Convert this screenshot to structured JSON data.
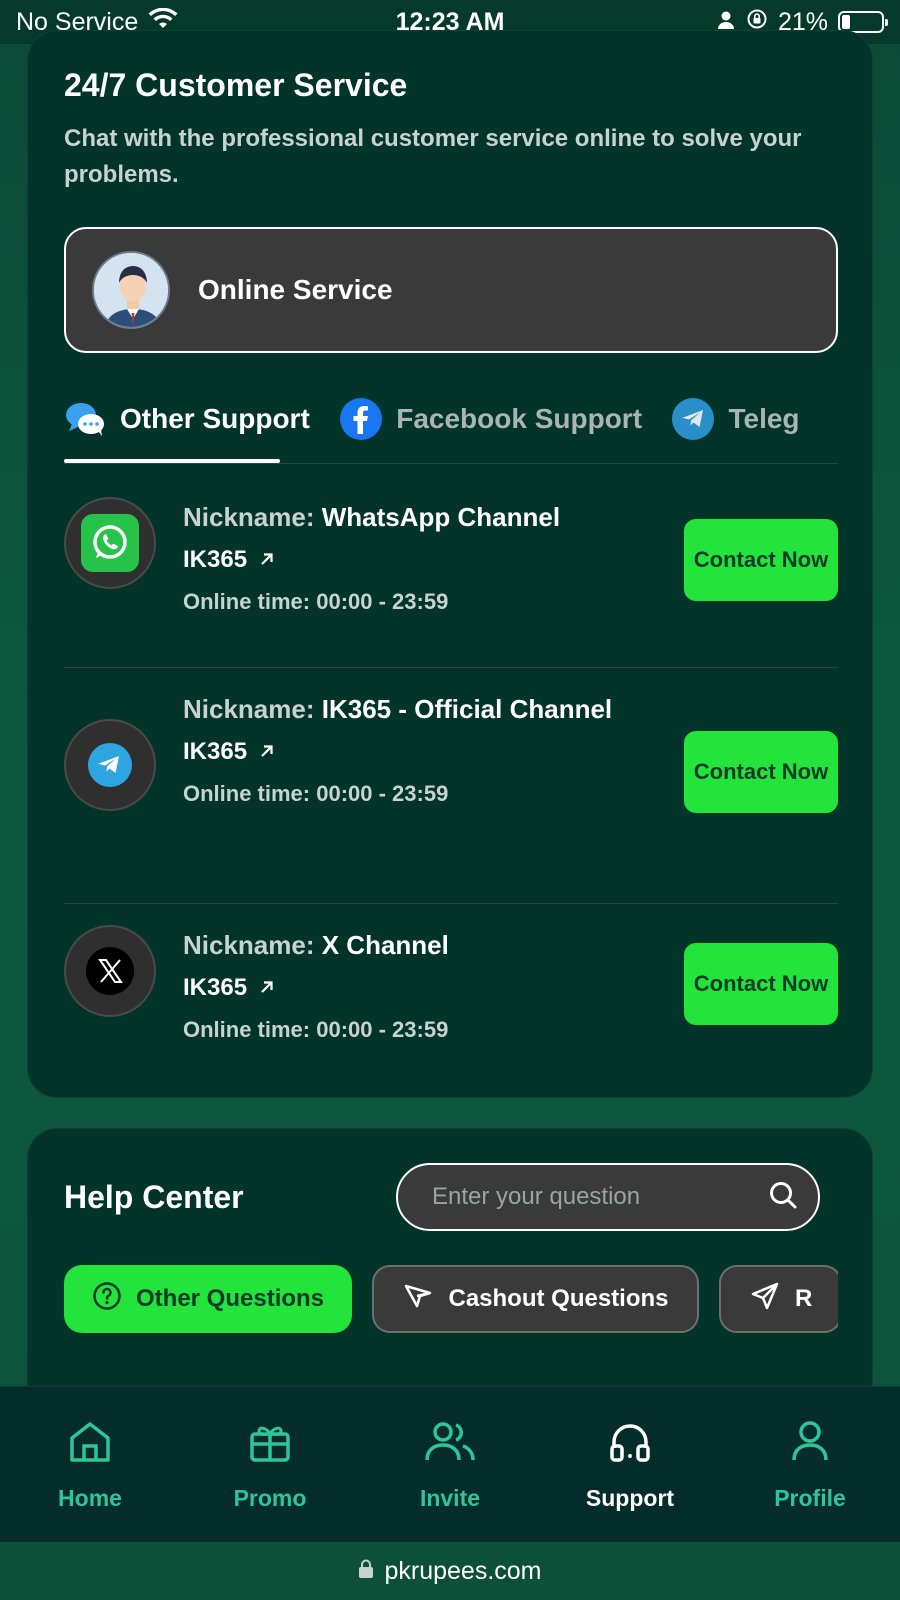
{
  "status_bar": {
    "carrier": "No Service",
    "time": "12:23 AM",
    "battery": "21%",
    "battery_level": 0.21
  },
  "customer_service": {
    "title": "24/7 Customer Service",
    "description": "Chat with the professional customer service online to solve your problems.",
    "online_service_label": "Online Service"
  },
  "support_tabs": [
    {
      "label": "Other Support",
      "icon": "chat-bubbles-icon",
      "active": true
    },
    {
      "label": "Facebook Support",
      "icon": "facebook-icon",
      "active": false
    },
    {
      "label": "Teleg",
      "icon": "telegram-icon",
      "active": false
    }
  ],
  "channels": [
    {
      "nickname_prefix": "Nickname:",
      "nickname": "WhatsApp Channel",
      "handle": "IK365",
      "online_time": "Online time: 00:00 - 23:59",
      "contact_label": "Contact Now",
      "icon": "whatsapp-icon"
    },
    {
      "nickname_prefix": "Nickname:",
      "nickname": "IK365 - Official Channel",
      "handle": "IK365",
      "online_time": "Online time: 00:00 - 23:59",
      "contact_label": "Contact Now",
      "icon": "telegram-icon"
    },
    {
      "nickname_prefix": "Nickname:",
      "nickname": "X Channel",
      "handle": "IK365",
      "online_time": "Online time: 00:00 - 23:59",
      "contact_label": "Contact Now",
      "icon": "x-logo-icon"
    }
  ],
  "help_center": {
    "title": "Help Center",
    "search_placeholder": "Enter your question",
    "question_tabs": [
      {
        "label": "Other Questions",
        "icon": "question-circle-icon",
        "active": true
      },
      {
        "label": "Cashout Questions",
        "icon": "send-icon",
        "active": false
      },
      {
        "label": "R",
        "icon": "send-icon",
        "active": false
      }
    ]
  },
  "bottom_nav": [
    {
      "label": "Home",
      "icon": "home-icon",
      "active": false
    },
    {
      "label": "Promo",
      "icon": "gift-icon",
      "active": false
    },
    {
      "label": "Invite",
      "icon": "users-icon",
      "active": false
    },
    {
      "label": "Support",
      "icon": "headphones-icon",
      "active": true
    },
    {
      "label": "Profile",
      "icon": "user-icon",
      "active": false
    }
  ],
  "url_bar": {
    "domain": "pkrupees.com"
  },
  "colors": {
    "accent_green": "#22e43a",
    "nav_teal": "#2fc59a",
    "card_bg": "#03342a"
  }
}
